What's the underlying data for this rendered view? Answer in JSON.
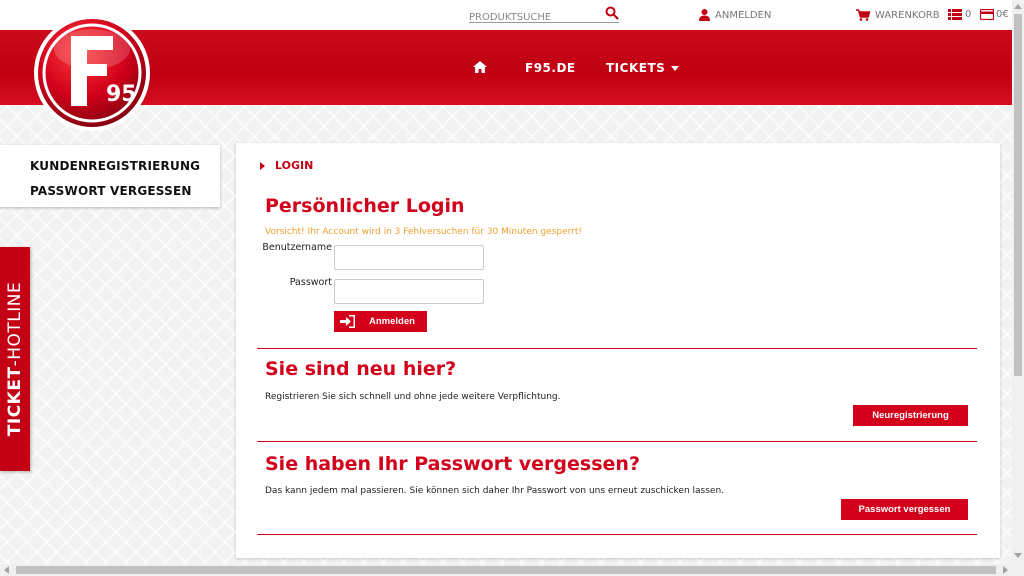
{
  "topbar": {
    "search_placeholder": "PRODUKTSUCHE",
    "login_label": "ANMELDEN",
    "cart_label": "WARENKORB",
    "list_count": "0",
    "cart_total": "0€"
  },
  "nav": {
    "home_icon": "home-icon",
    "f95": "F95.DE",
    "tickets": "TICKETS"
  },
  "logo": {
    "text": "95"
  },
  "sidebar": {
    "items": [
      {
        "label": "KUNDENREGISTRIERUNG"
      },
      {
        "label": "PASSWORT VERGESSEN"
      }
    ]
  },
  "hotline": {
    "bold": "TICKET",
    "rest": "-HOTLINE"
  },
  "main": {
    "breadcrumb": "LOGIN",
    "login": {
      "title": "Persönlicher Login",
      "warning": "Vorsicht! Ihr Account wird in 3 Fehlversuchen für 30 Minuten gesperrt!",
      "username_label": "Benutzername",
      "password_label": "Passwort",
      "button": "Anmelden"
    },
    "register": {
      "title": "Sie sind neu hier?",
      "text": "Registrieren Sie sich schnell und ohne jede weitere Verpflichtung.",
      "button": "Neuregistrierung"
    },
    "forgot": {
      "title": "Sie haben Ihr Passwort vergessen?",
      "text": "Das kann jedem mal passieren. Sie können sich daher Ihr Passwort von uns erneut zuschicken lassen.",
      "button": "Passwort vergessen"
    }
  },
  "colors": {
    "brand_red": "#d2001a",
    "warning": "#f0a030"
  }
}
